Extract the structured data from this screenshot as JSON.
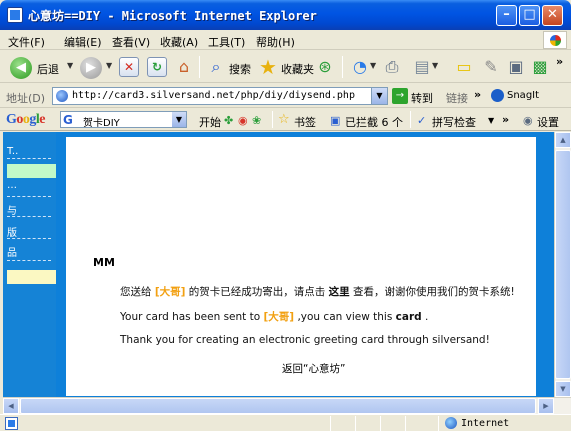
{
  "window": {
    "title": "心意坊==DIY - Microsoft Internet Explorer",
    "min_glyph": "–",
    "max_glyph": "□",
    "close_glyph": "✕"
  },
  "menu": [
    "文件(F)",
    "编辑(E)",
    "查看(V)",
    "收藏(A)",
    "工具(T)",
    "帮助(H)"
  ],
  "toolbar": {
    "back_label": "后退",
    "search_label": "搜索",
    "favorites_label": "收藏夹",
    "more": "»"
  },
  "address": {
    "label": "地址(D)",
    "url": "http://card3.silversand.net/php/diy/diysend.php",
    "go_label": "转到",
    "links_label": "链接",
    "snagit_label": "SnagIt"
  },
  "google": {
    "logo_parts": [
      "G",
      "o",
      "o",
      "g",
      "l",
      "e"
    ],
    "search_value": "贺卡DIY",
    "go_label": "开始",
    "bookmarks_label": "书签",
    "blocked_label": "已拦截 6 个",
    "spellcheck_label": "拼写检查",
    "more": "»",
    "settings_label": "设置"
  },
  "sidebar": {
    "items": [
      "T..",
      "…",
      "与",
      "版",
      "品"
    ]
  },
  "message": {
    "greeting": "MM",
    "cn_prefix": "您送给",
    "recipient": "[大哥]",
    "cn_mid": "的贺卡已经成功寄出，请点击",
    "cn_link": "这里",
    "cn_suffix": "查看，谢谢你使用我们的贺卡系统!",
    "en1_prefix": "Your card has been sent to",
    "en1_mid": ",you can view this",
    "en1_link": "card",
    "en1_suffix": ".",
    "en2": "Thank you for creating an electronic greeting card through silversand!",
    "return_link": "返回“心意坊”"
  },
  "status": {
    "zone_label": "Internet"
  },
  "colors": {
    "title_bar": "#0054e3",
    "page_background": "#0e80d9",
    "highlight": "#f2a011",
    "sidebar_green": "#c2f9c8",
    "sidebar_yellow": "#fbf8c2"
  }
}
